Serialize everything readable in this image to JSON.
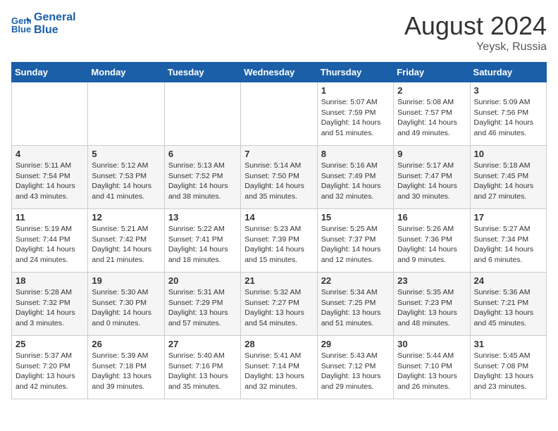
{
  "header": {
    "logo_line1": "General",
    "logo_line2": "Blue",
    "month_year": "August 2024",
    "location": "Yeysk, Russia"
  },
  "days_of_week": [
    "Sunday",
    "Monday",
    "Tuesday",
    "Wednesday",
    "Thursday",
    "Friday",
    "Saturday"
  ],
  "weeks": [
    [
      {
        "day": "",
        "info": ""
      },
      {
        "day": "",
        "info": ""
      },
      {
        "day": "",
        "info": ""
      },
      {
        "day": "",
        "info": ""
      },
      {
        "day": "1",
        "info": "Sunrise: 5:07 AM\nSunset: 7:59 PM\nDaylight: 14 hours\nand 51 minutes."
      },
      {
        "day": "2",
        "info": "Sunrise: 5:08 AM\nSunset: 7:57 PM\nDaylight: 14 hours\nand 49 minutes."
      },
      {
        "day": "3",
        "info": "Sunrise: 5:09 AM\nSunset: 7:56 PM\nDaylight: 14 hours\nand 46 minutes."
      }
    ],
    [
      {
        "day": "4",
        "info": "Sunrise: 5:11 AM\nSunset: 7:54 PM\nDaylight: 14 hours\nand 43 minutes."
      },
      {
        "day": "5",
        "info": "Sunrise: 5:12 AM\nSunset: 7:53 PM\nDaylight: 14 hours\nand 41 minutes."
      },
      {
        "day": "6",
        "info": "Sunrise: 5:13 AM\nSunset: 7:52 PM\nDaylight: 14 hours\nand 38 minutes."
      },
      {
        "day": "7",
        "info": "Sunrise: 5:14 AM\nSunset: 7:50 PM\nDaylight: 14 hours\nand 35 minutes."
      },
      {
        "day": "8",
        "info": "Sunrise: 5:16 AM\nSunset: 7:49 PM\nDaylight: 14 hours\nand 32 minutes."
      },
      {
        "day": "9",
        "info": "Sunrise: 5:17 AM\nSunset: 7:47 PM\nDaylight: 14 hours\nand 30 minutes."
      },
      {
        "day": "10",
        "info": "Sunrise: 5:18 AM\nSunset: 7:45 PM\nDaylight: 14 hours\nand 27 minutes."
      }
    ],
    [
      {
        "day": "11",
        "info": "Sunrise: 5:19 AM\nSunset: 7:44 PM\nDaylight: 14 hours\nand 24 minutes."
      },
      {
        "day": "12",
        "info": "Sunrise: 5:21 AM\nSunset: 7:42 PM\nDaylight: 14 hours\nand 21 minutes."
      },
      {
        "day": "13",
        "info": "Sunrise: 5:22 AM\nSunset: 7:41 PM\nDaylight: 14 hours\nand 18 minutes."
      },
      {
        "day": "14",
        "info": "Sunrise: 5:23 AM\nSunset: 7:39 PM\nDaylight: 14 hours\nand 15 minutes."
      },
      {
        "day": "15",
        "info": "Sunrise: 5:25 AM\nSunset: 7:37 PM\nDaylight: 14 hours\nand 12 minutes."
      },
      {
        "day": "16",
        "info": "Sunrise: 5:26 AM\nSunset: 7:36 PM\nDaylight: 14 hours\nand 9 minutes."
      },
      {
        "day": "17",
        "info": "Sunrise: 5:27 AM\nSunset: 7:34 PM\nDaylight: 14 hours\nand 6 minutes."
      }
    ],
    [
      {
        "day": "18",
        "info": "Sunrise: 5:28 AM\nSunset: 7:32 PM\nDaylight: 14 hours\nand 3 minutes."
      },
      {
        "day": "19",
        "info": "Sunrise: 5:30 AM\nSunset: 7:30 PM\nDaylight: 14 hours\nand 0 minutes."
      },
      {
        "day": "20",
        "info": "Sunrise: 5:31 AM\nSunset: 7:29 PM\nDaylight: 13 hours\nand 57 minutes."
      },
      {
        "day": "21",
        "info": "Sunrise: 5:32 AM\nSunset: 7:27 PM\nDaylight: 13 hours\nand 54 minutes."
      },
      {
        "day": "22",
        "info": "Sunrise: 5:34 AM\nSunset: 7:25 PM\nDaylight: 13 hours\nand 51 minutes."
      },
      {
        "day": "23",
        "info": "Sunrise: 5:35 AM\nSunset: 7:23 PM\nDaylight: 13 hours\nand 48 minutes."
      },
      {
        "day": "24",
        "info": "Sunrise: 5:36 AM\nSunset: 7:21 PM\nDaylight: 13 hours\nand 45 minutes."
      }
    ],
    [
      {
        "day": "25",
        "info": "Sunrise: 5:37 AM\nSunset: 7:20 PM\nDaylight: 13 hours\nand 42 minutes."
      },
      {
        "day": "26",
        "info": "Sunrise: 5:39 AM\nSunset: 7:18 PM\nDaylight: 13 hours\nand 39 minutes."
      },
      {
        "day": "27",
        "info": "Sunrise: 5:40 AM\nSunset: 7:16 PM\nDaylight: 13 hours\nand 35 minutes."
      },
      {
        "day": "28",
        "info": "Sunrise: 5:41 AM\nSunset: 7:14 PM\nDaylight: 13 hours\nand 32 minutes."
      },
      {
        "day": "29",
        "info": "Sunrise: 5:43 AM\nSunset: 7:12 PM\nDaylight: 13 hours\nand 29 minutes."
      },
      {
        "day": "30",
        "info": "Sunrise: 5:44 AM\nSunset: 7:10 PM\nDaylight: 13 hours\nand 26 minutes."
      },
      {
        "day": "31",
        "info": "Sunrise: 5:45 AM\nSunset: 7:08 PM\nDaylight: 13 hours\nand 23 minutes."
      }
    ]
  ]
}
